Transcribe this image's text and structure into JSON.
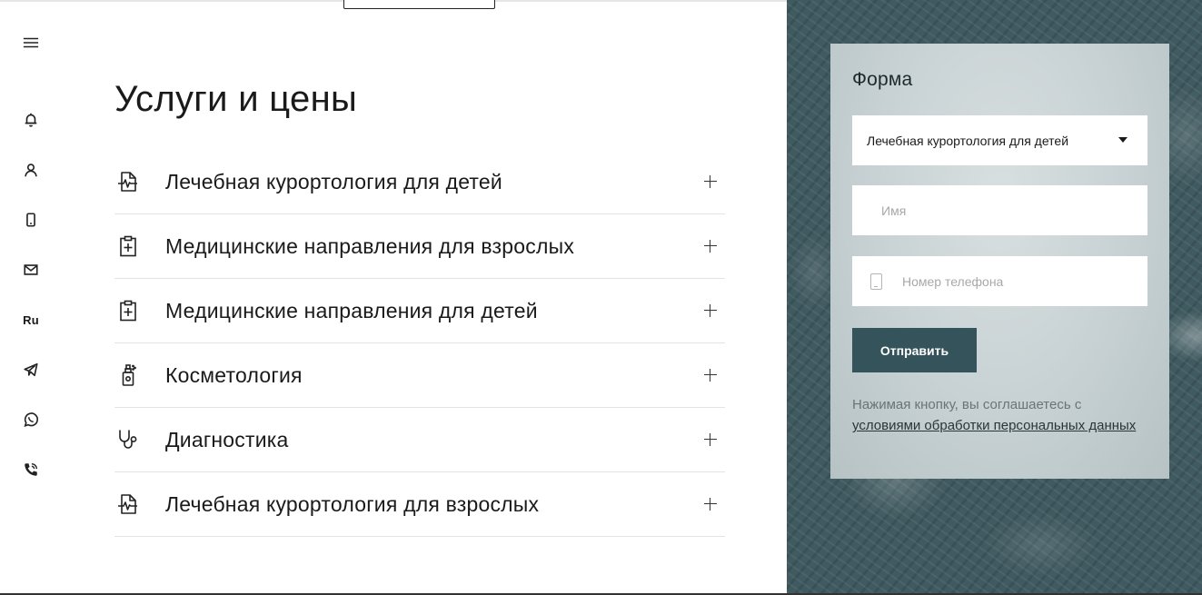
{
  "rail": {
    "lang": "Ru"
  },
  "services": {
    "title": "Услуги и цены",
    "items": [
      {
        "label": "Лечебная курортология для детей",
        "icon": "medical-file-icon"
      },
      {
        "label": "Медицинские направления для взрослых",
        "icon": "clipboard-plus-icon"
      },
      {
        "label": "Медицинские направления для детей",
        "icon": "clipboard-plus-icon"
      },
      {
        "label": "Косметология",
        "icon": "spray-bottle-icon"
      },
      {
        "label": "Диагностика",
        "icon": "stethoscope-icon"
      },
      {
        "label": "Лечебная курортология для взрослых",
        "icon": "medical-file-icon"
      }
    ]
  },
  "form": {
    "title": "Форма",
    "service_select_value": "Лечебная курортология для детей",
    "name_placeholder": "Имя",
    "phone_placeholder": "Номер телефона",
    "submit_label": "Отправить",
    "consent_text": "Нажимая кнопку, вы соглашаетесь с",
    "consent_link": "условиями обработки персональных данных"
  },
  "colors": {
    "accent": "#34535a",
    "panel_bg": "#3f5a60",
    "form_bg": "#c7d1d3"
  }
}
